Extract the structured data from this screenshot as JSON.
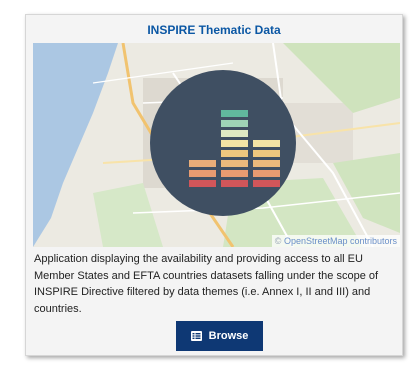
{
  "card": {
    "title": "INSPIRE Thematic Data",
    "description": "Application displaying the availability and providing access to all EU Member States and EFTA countries datasets falling under the scope of INSPIRE Directive filtered by data themes (i.e. Annex I, II and III) and countries.",
    "map": {
      "attribution_prefix": "© ",
      "attribution_link": "OpenStreetMap contributors"
    },
    "browse": {
      "label": "Browse",
      "icon": "list-icon"
    }
  },
  "colors": {
    "title": "#0b57a4",
    "button": "#0e3874",
    "circle": "#3f4f62",
    "water": "#abc7e3",
    "bars": [
      "#d1565a",
      "#e89b71",
      "#eec77e",
      "#f3e3a4",
      "#9fd4b6",
      "#61b89d"
    ]
  }
}
